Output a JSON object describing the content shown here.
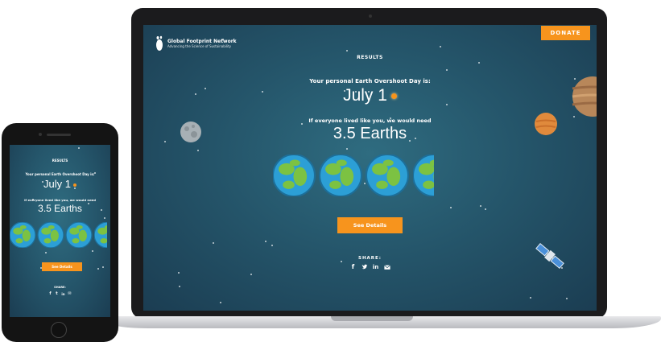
{
  "laptop": {
    "logo": {
      "name": "Global Footprint Network",
      "tagline": "Advancing the Science of Sustainability"
    },
    "donate_label": "DONATE",
    "results_label": "RESULTS",
    "overshoot_label": "Your personal Earth Overshoot Day is:",
    "overshoot_date": "July 1",
    "earths_label": "If everyone lived like you, we would need",
    "earths_value": "3.5 Earths",
    "earths_count": 3.5,
    "see_details_label": "See Details",
    "share_label": "SHARE:",
    "share_icons": [
      "facebook-icon",
      "twitter-icon",
      "linkedin-icon",
      "email-icon"
    ]
  },
  "phone": {
    "results_label": "RESULTS",
    "overshoot_label": "Your personal Earth Overshoot Day is:",
    "overshoot_date": "July 1",
    "earths_label": "If everyone lived like you, we would need",
    "earths_value": "3.5 Earths",
    "see_details_label": "See Details",
    "share_label": "SHARE:"
  },
  "colors": {
    "accent": "#f7941d",
    "background": "#25566b",
    "ocean": "#2c9fd6",
    "land": "#7cc242"
  }
}
